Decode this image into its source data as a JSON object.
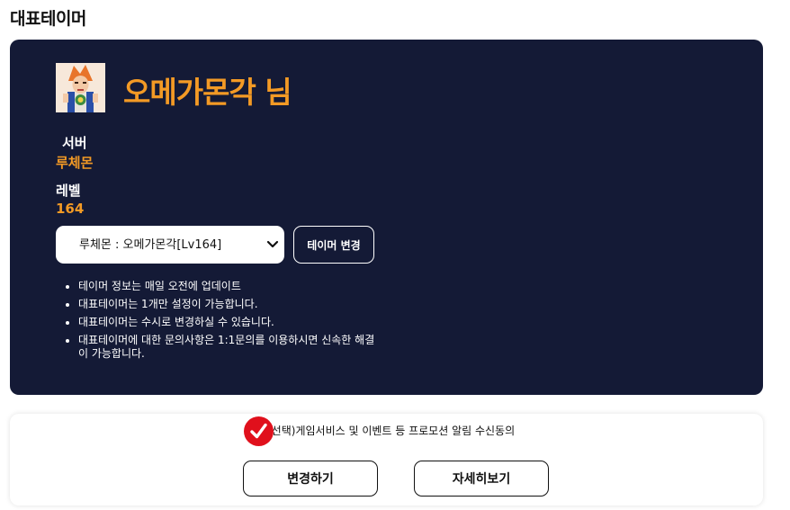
{
  "page": {
    "title": "대표테이머"
  },
  "character": {
    "name": "오메가몬각 님",
    "server_label": "서버",
    "server_value": "루체몬",
    "level_label": "레벨",
    "level_value": "164",
    "avatar_icon": "character-portrait-icon"
  },
  "selector": {
    "selected": "루체몬 : 오메가몬각[Lv164]",
    "change_label": "테이머 변경"
  },
  "notices": [
    "테이머 정보는 매일 오전에 업데이트",
    "대표테이머는 1개만 설정이 가능합니다.",
    "대표테이머는 수시로 변경하실 수 있습니다.",
    "대표테이머에 대한 문의사항은 1:1문의를 이용하시면 신속한 해결이 가능합니다."
  ],
  "consent": {
    "text": "(선택)게임서비스 및 이벤트 등 프로모션 알림 수신동의",
    "checked": true,
    "check_icon": "checkmark-icon"
  },
  "actions": {
    "apply_label": "변경하기",
    "details_label": "자세히보기"
  },
  "colors": {
    "card_background": "#141a36",
    "accent": "#f39a25",
    "check_badge": "#e0101c"
  }
}
